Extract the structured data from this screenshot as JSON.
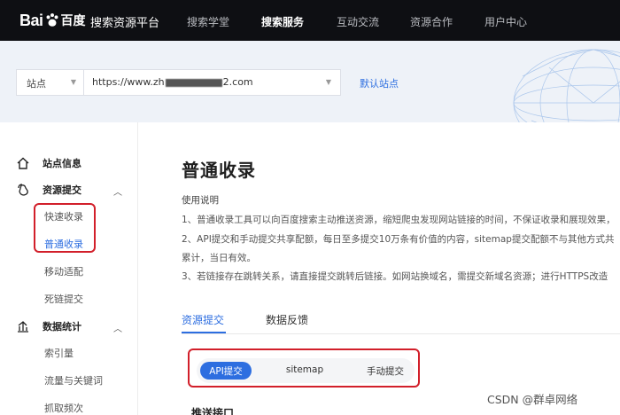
{
  "header": {
    "logo_left": "Bai",
    "logo_right": "百度",
    "platform_name": "搜索资源平台",
    "nav": [
      {
        "label": "搜索学堂"
      },
      {
        "label": "搜索服务"
      },
      {
        "label": "互动交流"
      },
      {
        "label": "资源合作"
      },
      {
        "label": "用户中心"
      }
    ],
    "active_nav": "搜索服务"
  },
  "site_bar": {
    "site_select_label": "站点",
    "url_prefix": "https://www.zh",
    "url_suffix": "2.com",
    "default_site_link": "默认站点"
  },
  "sidebar": {
    "groups": [
      {
        "label": "站点信息",
        "icon": "home-icon"
      },
      {
        "label": "资源提交",
        "icon": "submit-icon",
        "expanded": true
      },
      {
        "label": "数据统计",
        "icon": "stats-icon",
        "expanded": true
      }
    ],
    "submit_items": [
      {
        "label": "快速收录"
      },
      {
        "label": "普通收录",
        "active": true
      },
      {
        "label": "移动适配"
      },
      {
        "label": "死链提交"
      }
    ],
    "stats_items": [
      {
        "label": "索引量"
      },
      {
        "label": "流量与关键词"
      },
      {
        "label": "抓取频次"
      }
    ]
  },
  "main": {
    "title": "普通收录",
    "usage_title": "使用说明",
    "usage_lines": [
      "1、普通收录工具可以向百度搜索主动推送资源，缩短爬虫发现网站链接的时间，不保证收录和展现效果，",
      "2、API提交和手动提交共享配额，每日至多提交10万条有价值的内容，sitemap提交配额不与其他方式共",
      "累计，当日有效。",
      "3、若链接存在跳转关系，请直接提交跳转后链接。如网站换域名，需提交新域名资源；进行HTTPS改造"
    ],
    "tabs": [
      {
        "label": "资源提交",
        "active": true
      },
      {
        "label": "数据反馈"
      }
    ],
    "methods": [
      {
        "label": "API提交",
        "active": true
      },
      {
        "label": "sitemap"
      },
      {
        "label": "手动提交"
      }
    ],
    "section_title": "推送接口"
  },
  "watermark": "CSDN @群卓网络",
  "colors": {
    "accent": "#2d6ee0",
    "highlight_box": "#d21f2a",
    "topbar": "#0e0f13"
  }
}
